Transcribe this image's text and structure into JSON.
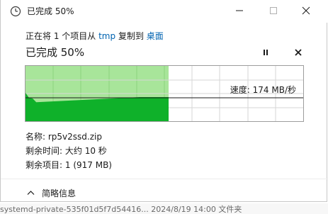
{
  "window": {
    "title": "已完成 50%"
  },
  "copy": {
    "prefix": "正在将 1 个项目从",
    "source": "tmp",
    "middle": "复制到",
    "destination": "桌面"
  },
  "progress": {
    "title": "已完成 50%",
    "fraction": 0.5,
    "speed_label": "速度: 174 MB/秒",
    "colors": {
      "fill_light": "#a8e59a",
      "fill_dark": "#0fb12a",
      "grid": "#8bd47d"
    }
  },
  "details": {
    "name_label": "名称:",
    "name_value": "rp5v2ssd.zip",
    "time_label": "剩余时间:",
    "time_value": "大约 10 秒",
    "items_label": "剩余项目:",
    "items_value": "1 (917 MB)"
  },
  "footer": {
    "less_info_label": "简略信息"
  },
  "background": {
    "row_text": "systemd-private-535f01d5f7d54416...   2024/8/19 14:00   文件夹"
  }
}
